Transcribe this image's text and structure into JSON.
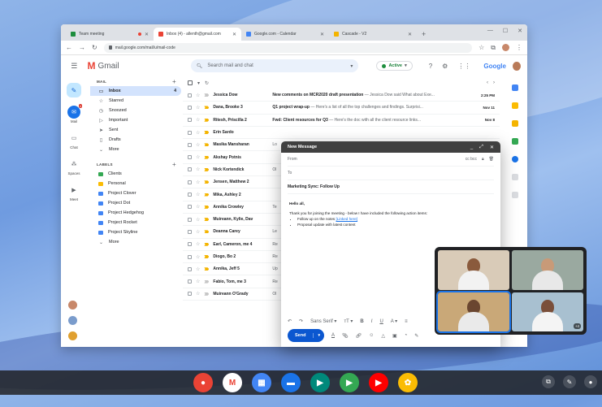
{
  "browser": {
    "tabs": [
      {
        "title": "Team meeting",
        "color": "#1e8e3e"
      },
      {
        "title": "Inbox (4) - allenth@gmail.com",
        "color": "#ea4335"
      },
      {
        "title": "Google.com - Calendar",
        "color": "#4285f4"
      },
      {
        "title": "Cascade - V2",
        "color": "#f4b400"
      }
    ],
    "url": "mail.google.com/mail/u/mail-code"
  },
  "gmail": {
    "logo_text": "Gmail",
    "search_placeholder": "Search mail and chat",
    "status": "Active",
    "google_word": "Google"
  },
  "rail": [
    {
      "label": "Mail",
      "icon": "mail-icon",
      "badge": "4"
    },
    {
      "label": "Chat",
      "icon": "chat-icon"
    },
    {
      "label": "Spaces",
      "icon": "spaces-icon"
    },
    {
      "label": "Meet",
      "icon": "video-icon"
    }
  ],
  "sidebar": {
    "mail_heading": "MAIL",
    "mail_items": [
      {
        "label": "Inbox",
        "icon": "inbox-icon",
        "count": "4"
      },
      {
        "label": "Starred",
        "icon": "star-icon"
      },
      {
        "label": "Snoozed",
        "icon": "clock-icon"
      },
      {
        "label": "Important",
        "icon": "label-icon"
      },
      {
        "label": "Sent",
        "icon": "send-icon"
      },
      {
        "label": "Drafts",
        "icon": "draft-icon"
      },
      {
        "label": "More",
        "icon": "chevron-down-icon"
      }
    ],
    "labels_heading": "LABELS",
    "labels": [
      {
        "label": "Clients",
        "color": "#34a853"
      },
      {
        "label": "Personal",
        "color": "#fbbc04"
      },
      {
        "label": "Project Clover",
        "color": "#4285f4"
      },
      {
        "label": "Project Dot",
        "color": "#4285f4"
      },
      {
        "label": "Project Hedgehog",
        "color": "#4285f4"
      },
      {
        "label": "Project Rocket",
        "color": "#4285f4"
      },
      {
        "label": "Project Skyline",
        "color": "#4285f4"
      }
    ],
    "labels_more": "More"
  },
  "emails": [
    {
      "sender": "Jessica Dow",
      "subject": "New comments on MCR2020 draft presentation",
      "snippet": " — Jessica Dow said What about Exe...",
      "date": "2:25 PM",
      "important": false
    },
    {
      "sender": "Dana, Brooke 3",
      "subject": "Q1 project wrap-up",
      "snippet": " — Here's a list of all the top challenges and findings. Surprisi...",
      "date": "Nov 11",
      "important": true
    },
    {
      "sender": "Ritesh, Priscilla 2",
      "subject": "Fwd: Client resources for Q3",
      "snippet": " — Here's the doc with all the client resource links...",
      "date": "Nov 8",
      "important": true
    },
    {
      "sender": "Erin Sardo",
      "subject": "",
      "snippet": "",
      "date": "",
      "important": true
    },
    {
      "sender": "Masika Mansharan",
      "subject": "",
      "snippet": "Lo",
      "date": "",
      "important": true
    },
    {
      "sender": "Akshay Potnis",
      "subject": "",
      "snippet": "",
      "date": "",
      "important": true
    },
    {
      "sender": "Nick Kortendick",
      "subject": "",
      "snippet": "Ol",
      "date": "",
      "important": true
    },
    {
      "sender": "Jensen, Matthew 2",
      "subject": "",
      "snippet": "",
      "date": "",
      "important": true
    },
    {
      "sender": "Mika, Ashley 2",
      "subject": "",
      "snippet": "",
      "date": "",
      "important": true
    },
    {
      "sender": "Annika Crowley",
      "subject": "",
      "snippet": "Te",
      "date": "",
      "important": true
    },
    {
      "sender": "Muireann, Kylie, Dav",
      "subject": "",
      "snippet": "",
      "date": "",
      "important": true
    },
    {
      "sender": "Deanna Carey",
      "subject": "",
      "snippet": "Le",
      "date": "",
      "important": true
    },
    {
      "sender": "Earl, Cameron, me 4",
      "subject": "",
      "snippet": "Re",
      "date": "",
      "important": true
    },
    {
      "sender": "Diogo, Bo 2",
      "subject": "",
      "snippet": "Re",
      "date": "",
      "important": true
    },
    {
      "sender": "Annika, Jeff 5",
      "subject": "",
      "snippet": "Up",
      "date": "",
      "important": true
    },
    {
      "sender": "Fabio, Tom, me 3",
      "subject": "",
      "snippet": "Re",
      "date": "",
      "important": false
    },
    {
      "sender": "Muireann O'Grady",
      "subject": "",
      "snippet": "Ol",
      "date": "",
      "important": false
    }
  ],
  "compose": {
    "title": "New Message",
    "from_label": "From",
    "to_label": "To",
    "cc_bcc": "cc bcc",
    "subject": "Marketing Sync: Follow Up",
    "greeting": "Hello all,",
    "intro": "Thank you for joining the meeting - below I have included the following action items:",
    "bullet1_prefix": "Follow up on the notes ",
    "bullet1_link": "[Linked here]",
    "bullet2": "Proposal update with latest content",
    "font_name": "Sans Serif",
    "send_label": "Send"
  },
  "meet": {
    "more_count": "+4"
  },
  "shelf": {
    "apps": [
      {
        "name": "chrome-icon",
        "color": "#ea4335",
        "glyph": "●"
      },
      {
        "name": "gmail-icon",
        "color": "#ffffff",
        "glyph": "M"
      },
      {
        "name": "calendar-icon",
        "color": "#4285f4",
        "glyph": "▦"
      },
      {
        "name": "files-icon",
        "color": "#1a73e8",
        "glyph": "▬"
      },
      {
        "name": "meet-icon",
        "color": "#00897b",
        "glyph": "▶"
      },
      {
        "name": "play-store-icon",
        "color": "#34a853",
        "glyph": "▶"
      },
      {
        "name": "youtube-icon",
        "color": "#ff0000",
        "glyph": "▶"
      },
      {
        "name": "photos-icon",
        "color": "#fbbc04",
        "glyph": "✿"
      }
    ]
  }
}
